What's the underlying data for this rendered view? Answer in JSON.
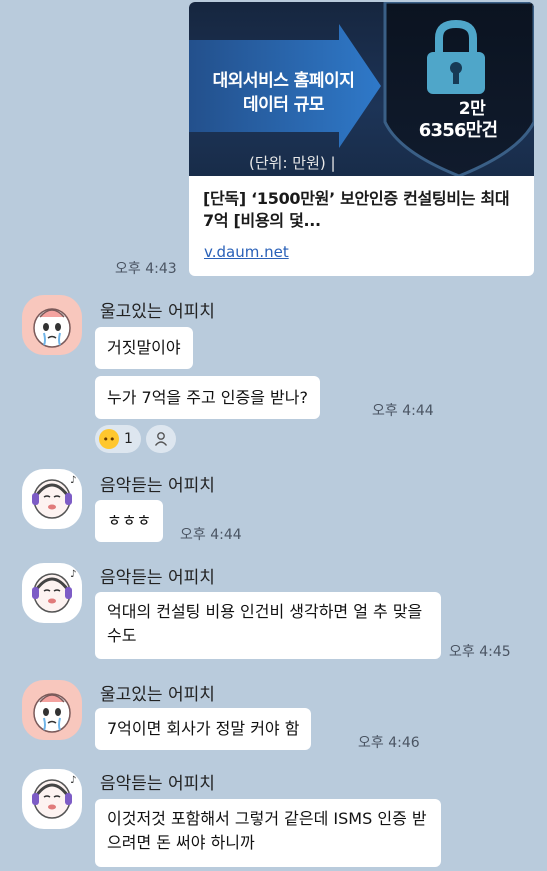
{
  "link_card": {
    "thumb_line1": "대외서비스 홈페이지",
    "thumb_line2": "데이터 규모",
    "thumb_amount1": "2만",
    "thumb_amount2": "6356만건",
    "thumb_unit": "(단위: 만원) |",
    "title": "[단독] ‘1500만원’ 보안인증 컨설팅비는 최대 7억 [비용의 덫...",
    "url": "v.daum.net",
    "time": "오후 4:43"
  },
  "messages": [
    {
      "sender": "울고있는 어피치",
      "avatar": "crying-apeach-avatar",
      "bubbles": [
        {
          "text": "거짓말이야"
        },
        {
          "text": "누가 7억을 주고 인증을 받나?",
          "time": "오후 4:44",
          "reaction": {
            "emoji": "crying-face-icon",
            "count": "1"
          }
        }
      ]
    },
    {
      "sender": "음악듣는 어피치",
      "avatar": "music-apeach-avatar",
      "bubbles": [
        {
          "text": "ㅎㅎㅎ",
          "time": "오후 4:44"
        }
      ]
    },
    {
      "sender": "음악듣는 어피치",
      "avatar": "music-apeach-avatar",
      "bubbles": [
        {
          "text": "억대의 컨설팅 비용 인건비 생각하면 얼 추 맞을수도",
          "time": "오후 4:45"
        }
      ]
    },
    {
      "sender": "울고있는 어피치",
      "avatar": "crying-apeach-avatar",
      "bubbles": [
        {
          "text": "7억이면 회사가 정말 커야 함",
          "time": "오후 4:46"
        }
      ]
    },
    {
      "sender": "음악듣는 어피치",
      "avatar": "music-apeach-avatar",
      "bubbles": [
        {
          "text": "이것저것 포함해서 그렇거 같은데 ISMS 인증 받으려면 돈 써야 하니까"
        }
      ]
    }
  ],
  "colors": {
    "chat_background": "#b9cbdc",
    "bubble": "#ffffff",
    "link": "#2a61b8"
  }
}
